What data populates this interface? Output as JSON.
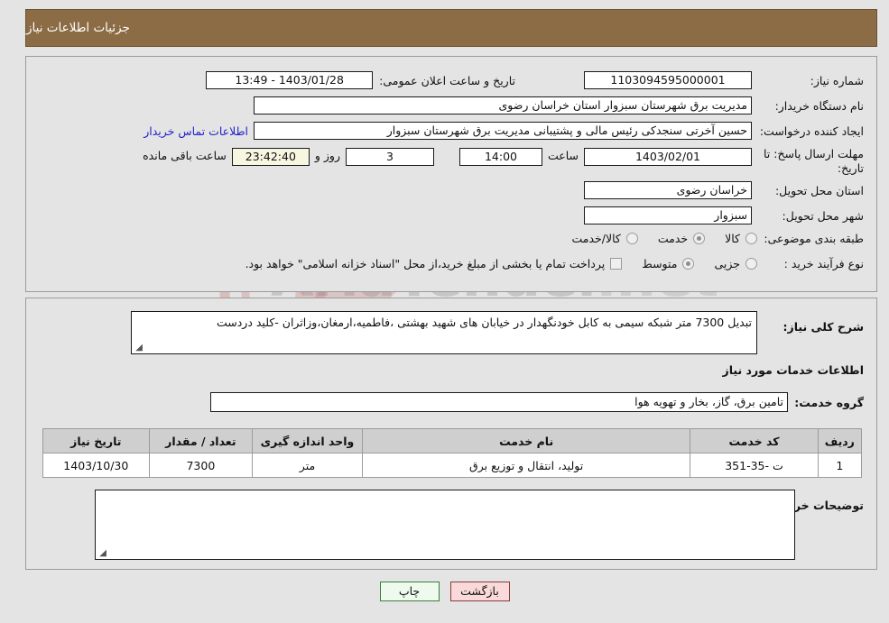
{
  "header": {
    "title": "جزئیات اطلاعات نیاز"
  },
  "watermark": {
    "text": "AriaTender",
    "suffix": ".net",
    "shield_icon": "shield-icon"
  },
  "form": {
    "need_number": {
      "label": "شماره نیاز:",
      "value": "1103094595000001"
    },
    "announce_datetime": {
      "label": "تاریخ و ساعت اعلان عمومی:",
      "value": "13:49 - 1403/01/28"
    },
    "buyer_org": {
      "label": "نام دستگاه خریدار:",
      "value": "مدیریت برق شهرستان سبزوار استان خراسان رضوی"
    },
    "creator": {
      "label": "ایجاد کننده درخواست:",
      "value": "حسین آخرتی سنجدکی رئیس مالی و پشتیبانی مدیریت برق شهرستان سبزوار",
      "link_label": "اطلاعات تماس خریدار"
    },
    "deadline": {
      "label": "مهلت ارسال پاسخ: تا تاریخ:",
      "date": "1403/02/01",
      "hour_label": "ساعت",
      "hour_value": "14:00",
      "days_value": "3",
      "days_label": "روز و",
      "countdown_value": "23:42:40",
      "remaining_label": "ساعت باقی مانده"
    },
    "province": {
      "label": "استان محل تحویل:",
      "value": "خراسان رضوی"
    },
    "city": {
      "label": "شهر محل تحویل:",
      "value": "سبزوار"
    },
    "category": {
      "label": "طبقه بندی موضوعی:",
      "options": [
        {
          "label": "کالا",
          "selected": false
        },
        {
          "label": "خدمت",
          "selected": true
        },
        {
          "label": "کالا/خدمت",
          "selected": false
        }
      ]
    },
    "purchase_type": {
      "label": "نوع فرآیند خرید :",
      "options": [
        {
          "label": "جزیی",
          "selected": false
        },
        {
          "label": "متوسط",
          "selected": true
        }
      ],
      "checkbox_note": "پرداخت تمام یا بخشی از مبلغ خرید،از محل \"اسناد خزانه اسلامی\" خواهد بود.",
      "checkbox_checked": false
    }
  },
  "description": {
    "label": "شرح کلی نیاز:",
    "value": "تبدیل 7300 متر شبکه سیمی به کابل خودنگهدار در خیابان های شهید بهشتی ،فاطمیه،ارمغان،وزاثران -کلید دردست"
  },
  "services_section": {
    "title": "اطلاعات خدمات مورد نیاز",
    "service_group": {
      "label": "گروه خدمت:",
      "value": "تامین برق، گاز، بخار و تهویه هوا"
    },
    "table": {
      "columns": [
        "ردیف",
        "کد خدمت",
        "نام خدمت",
        "واحد اندازه گیری",
        "تعداد / مقدار",
        "تاریخ نیاز"
      ],
      "rows": [
        {
          "row_no": "1",
          "service_code": "ت -35-351",
          "service_name": "تولید، انتقال و توزیع برق",
          "unit": "متر",
          "quantity": "7300",
          "need_date": "1403/10/30"
        }
      ]
    }
  },
  "buyer_comments": {
    "label": "توضیحات خریدار:",
    "value": ""
  },
  "buttons": {
    "back": "بازگشت",
    "print": "چاپ"
  },
  "colors": {
    "header_bg": "#8c6c44",
    "page_bg": "#e4e4e4",
    "link": "#2222cc",
    "countdown_bg": "#f7f6e1",
    "back_btn_bg": "#f9d9d9",
    "print_btn_bg": "#edfaed",
    "table_header_bg": "#cfcfcf"
  }
}
